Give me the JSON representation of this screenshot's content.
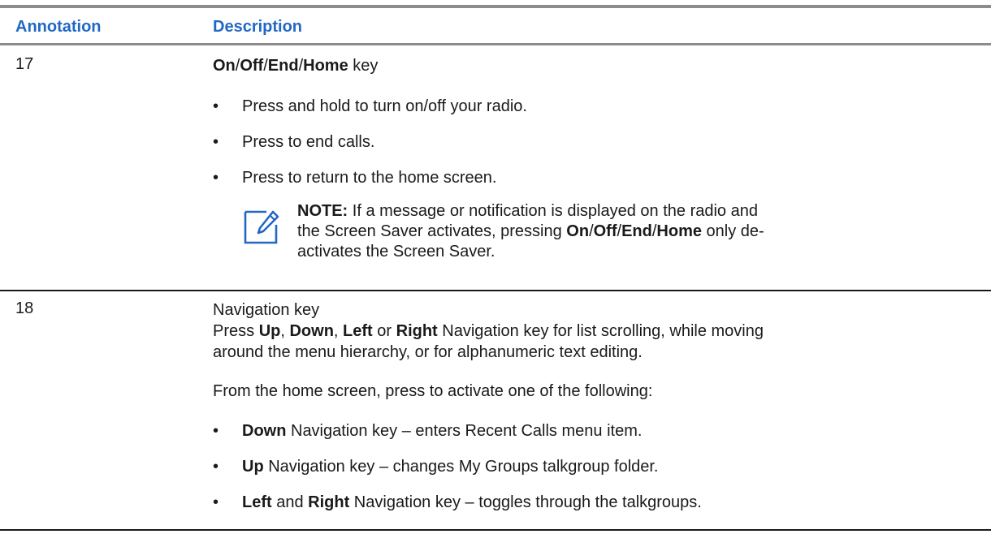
{
  "header": {
    "annotation": "Annotation",
    "description": "Description"
  },
  "rows": [
    {
      "annotation": "17",
      "title": {
        "on": "On",
        "off": "Off",
        "end": "End",
        "home": "Home",
        "slash": "/",
        "suffix": " key"
      },
      "bullets": [
        "Press and hold to turn on/off your radio.",
        "Press to end calls.",
        "Press to return to the home screen."
      ],
      "note": {
        "label": "NOTE:",
        "text1": " If a message or notification is displayed on the radio and",
        "text2": "the Screen Saver activates, pressing ",
        "on": "On",
        "off": "Off",
        "end": "End",
        "home": "Home",
        "slash": "/",
        "text3": " only de-",
        "text4": "activates the Screen Saver."
      }
    },
    {
      "annotation": "18",
      "title": "Navigation key",
      "para1": {
        "pre": "Press ",
        "up": "Up",
        "comma1": ", ",
        "down": "Down",
        "comma2": ", ",
        "left": "Left",
        "or": " or ",
        "right": "Right",
        "post1": " Navigation key for list scrolling, while moving",
        "post2": "around the menu hierarchy, or for alphanumeric text editing."
      },
      "para2": "From the home screen, press to activate one of the following:",
      "bullets": [
        {
          "key": "Down",
          "text": " Navigation key – enters Recent Calls menu item."
        },
        {
          "key": "Up",
          "text": " Navigation key – changes My Groups talkgroup folder."
        },
        {
          "key": "Left",
          "and": " and ",
          "key2": "Right",
          "text": " Navigation key – toggles through the talkgroups."
        }
      ]
    }
  ],
  "colors": {
    "header_text": "#2168c4",
    "rule": "#8c8c8c",
    "note_icon": "#2168c4"
  },
  "icons": {
    "note": "note-edit-icon",
    "bullet": "bullet-dot"
  }
}
